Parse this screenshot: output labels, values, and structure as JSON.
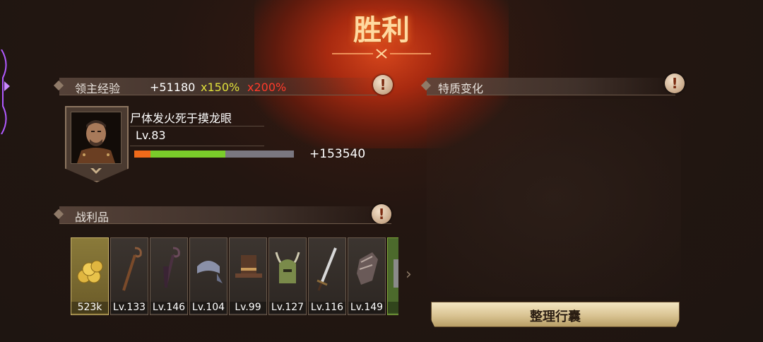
{
  "header": {
    "title": "胜利"
  },
  "exp_section": {
    "title": "领主经验",
    "exp_gain": "+51180",
    "multiplier_1": "x150%",
    "multiplier_2": "x200%"
  },
  "hero": {
    "name": "尸体发火死于摸龙眼",
    "level": "Lv.83",
    "xp_gained": "+153540",
    "xp_bar": {
      "previous_fraction": 0.1,
      "gained_fraction": 0.47
    }
  },
  "traits_section": {
    "title": "特质变化"
  },
  "loot_section": {
    "title": "战利品",
    "items": [
      {
        "icon": "gold-coins-icon",
        "label": "523k"
      },
      {
        "icon": "wooden-staff-icon",
        "label": "Lv.133"
      },
      {
        "icon": "dark-staff-icon",
        "label": "Lv.146"
      },
      {
        "icon": "bandana-icon",
        "label": "Lv.104"
      },
      {
        "icon": "top-hat-icon",
        "label": "Lv.99"
      },
      {
        "icon": "horned-helmet-icon",
        "label": "Lv.127"
      },
      {
        "icon": "sword-icon",
        "label": "Lv.116"
      },
      {
        "icon": "gauntlet-icon",
        "label": "Lv.149"
      },
      {
        "icon": "partial-item-icon",
        "label": "Lv"
      }
    ]
  },
  "actions": {
    "organize_label": "整理行囊"
  },
  "colors": {
    "accent_red": "#ff3a2a",
    "accent_yellow": "#e0e03a",
    "xp_green": "#7acc2a",
    "xp_orange": "#f06a1a"
  }
}
